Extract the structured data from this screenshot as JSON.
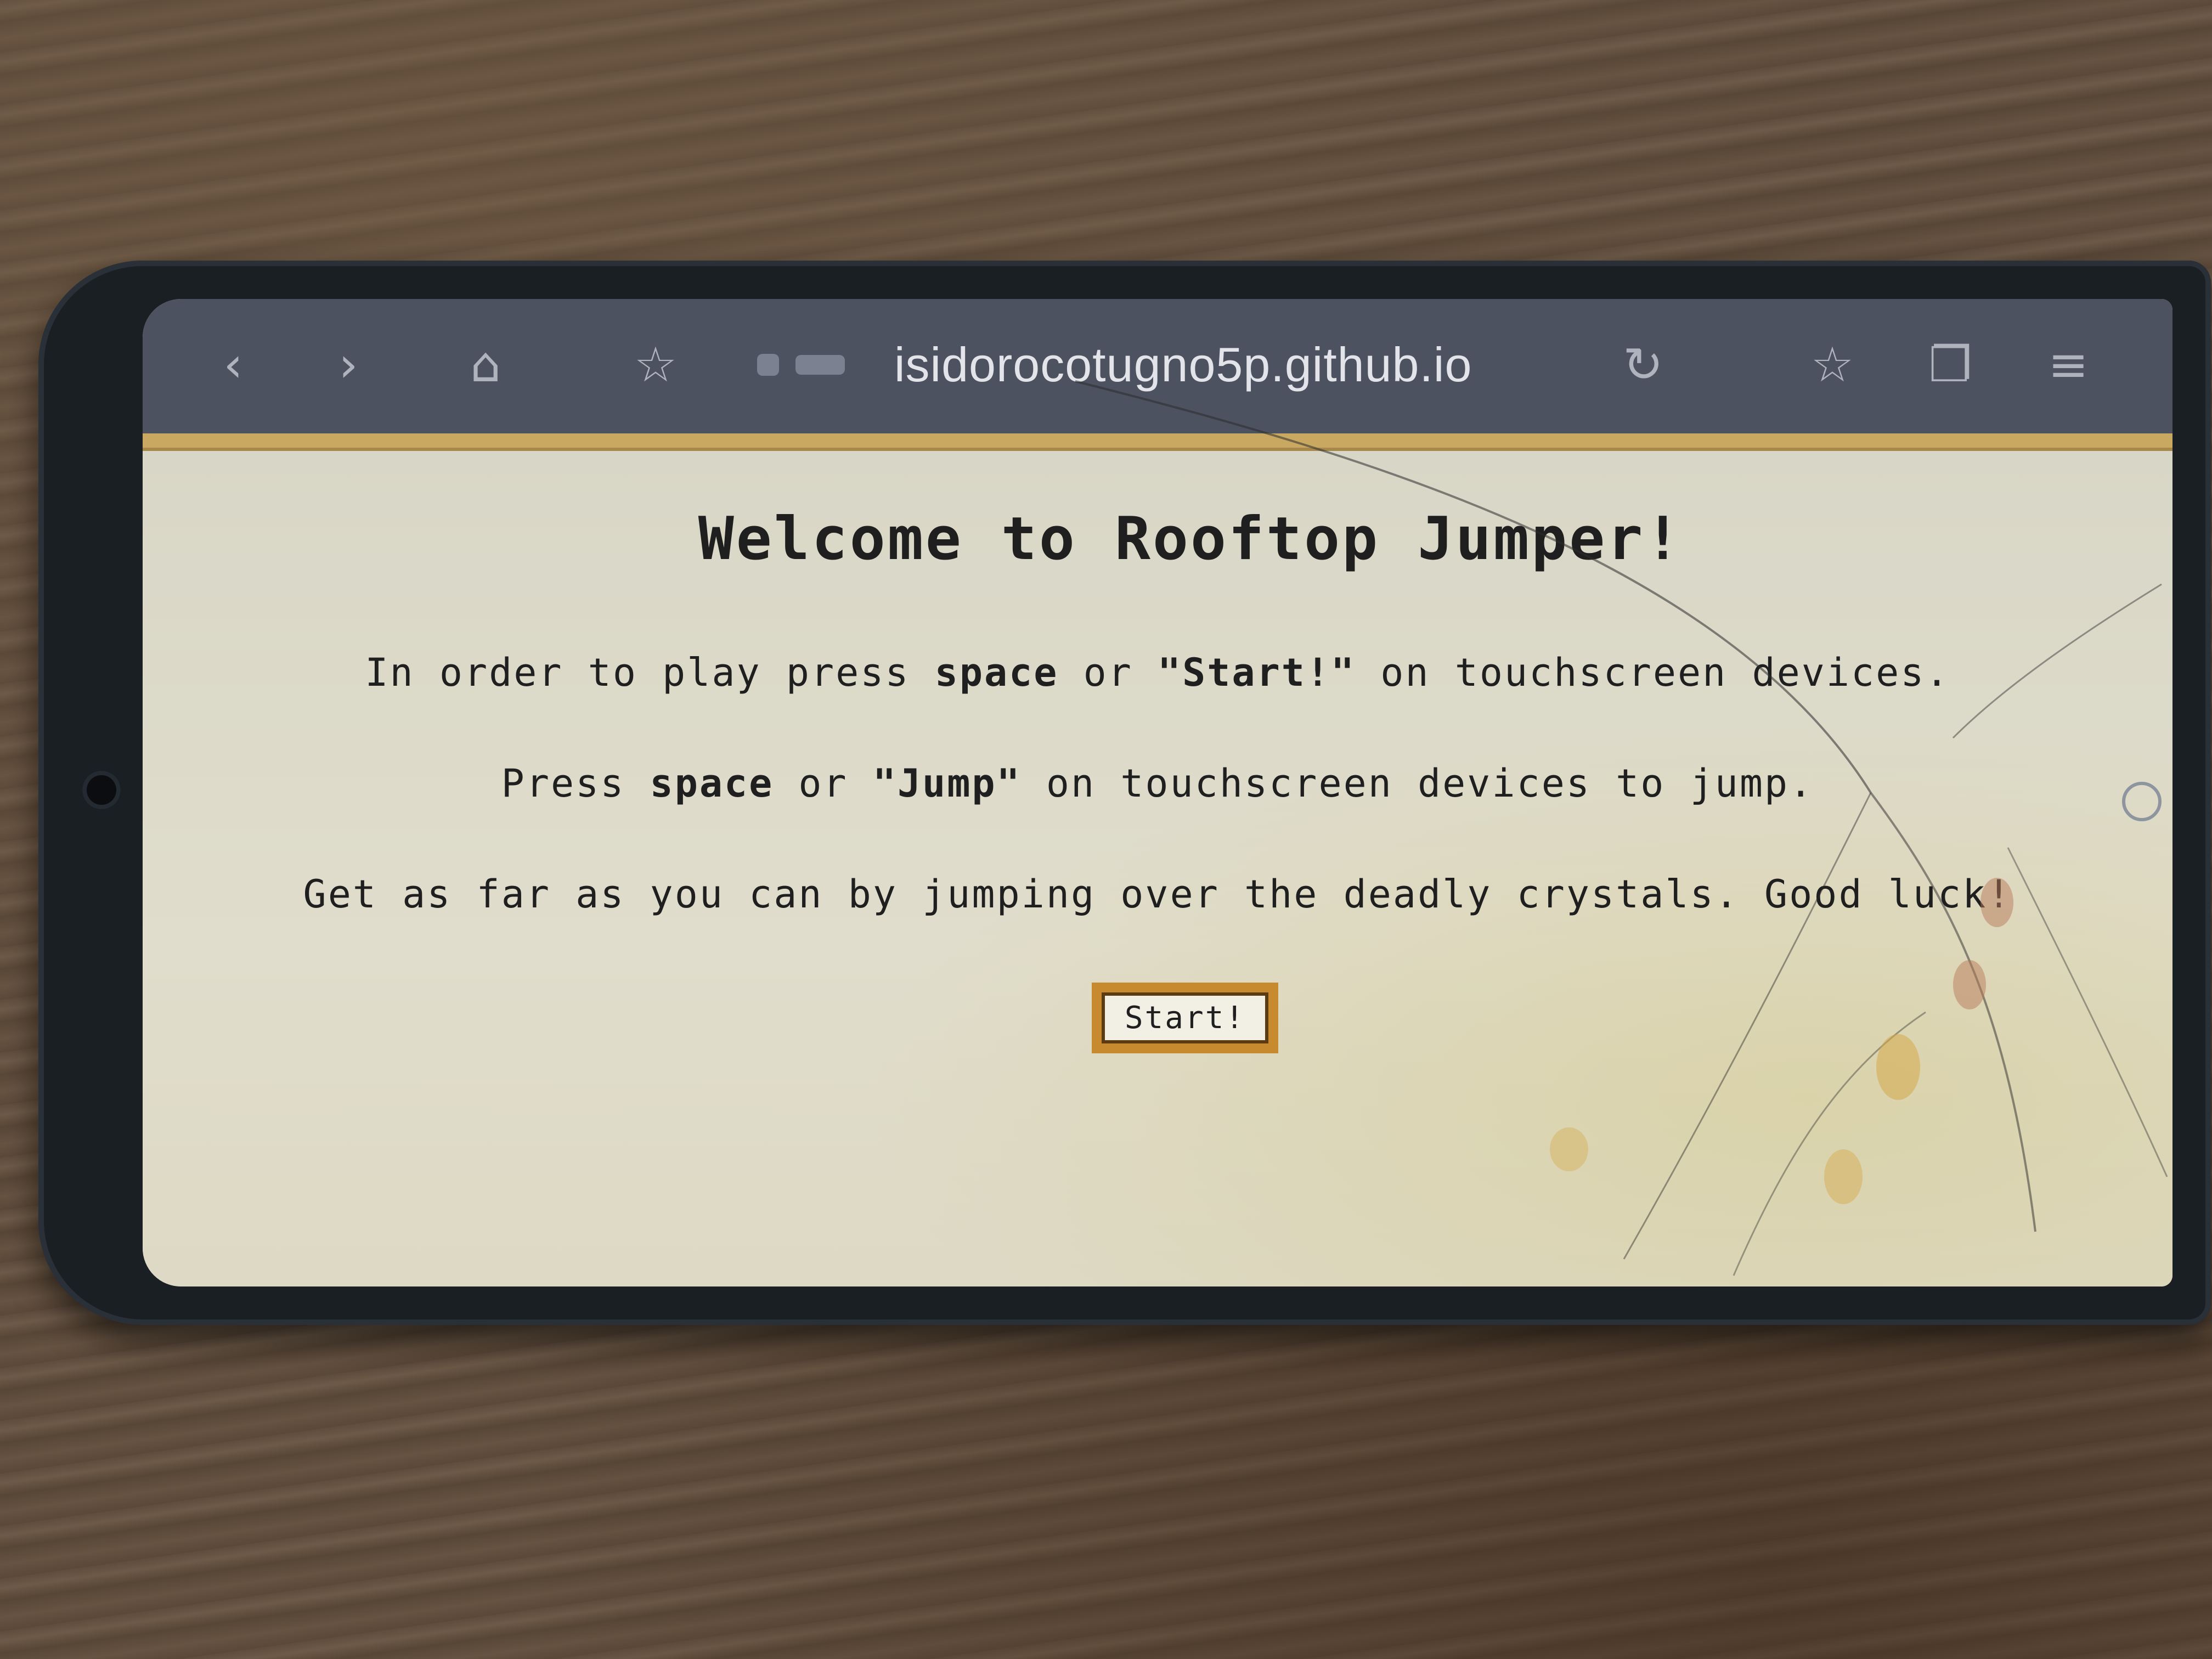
{
  "browser": {
    "url": "isidorocotugno5p.github.io",
    "icons": {
      "back": "chevron-left-icon",
      "forward": "chevron-right-icon",
      "home": "home-icon",
      "bookmark": "star-icon",
      "reload": "reload-icon",
      "bookmarks": "star-list-icon",
      "tabs": "tabs-icon",
      "menu": "menu-icon"
    },
    "glyphs": {
      "back": "‹",
      "forward": "›",
      "home": "⌂",
      "bookmark": "☆",
      "reload": "↻",
      "bookmarks": "☆",
      "tabs": "❐",
      "menu": "≡"
    }
  },
  "page": {
    "title": "Welcome to Rooftop Jumper!",
    "line1": {
      "a": "In order to play press ",
      "b": "space",
      "c": " or ",
      "d": "\"Start!\"",
      "e": " on touchscreen devices."
    },
    "line2": {
      "a": "Press ",
      "b": "space",
      "c": " or ",
      "d": "\"Jump\"",
      "e": " on touchscreen devices to jump."
    },
    "line3": "Get as far as you can by jumping over the deadly crystals. Good luck!",
    "start_label": "Start!"
  },
  "colors": {
    "toolbar": "#4d5260",
    "page_bg": "#dcdac8",
    "button_border": "#c78a2f",
    "accent_border": "#c9a961"
  }
}
